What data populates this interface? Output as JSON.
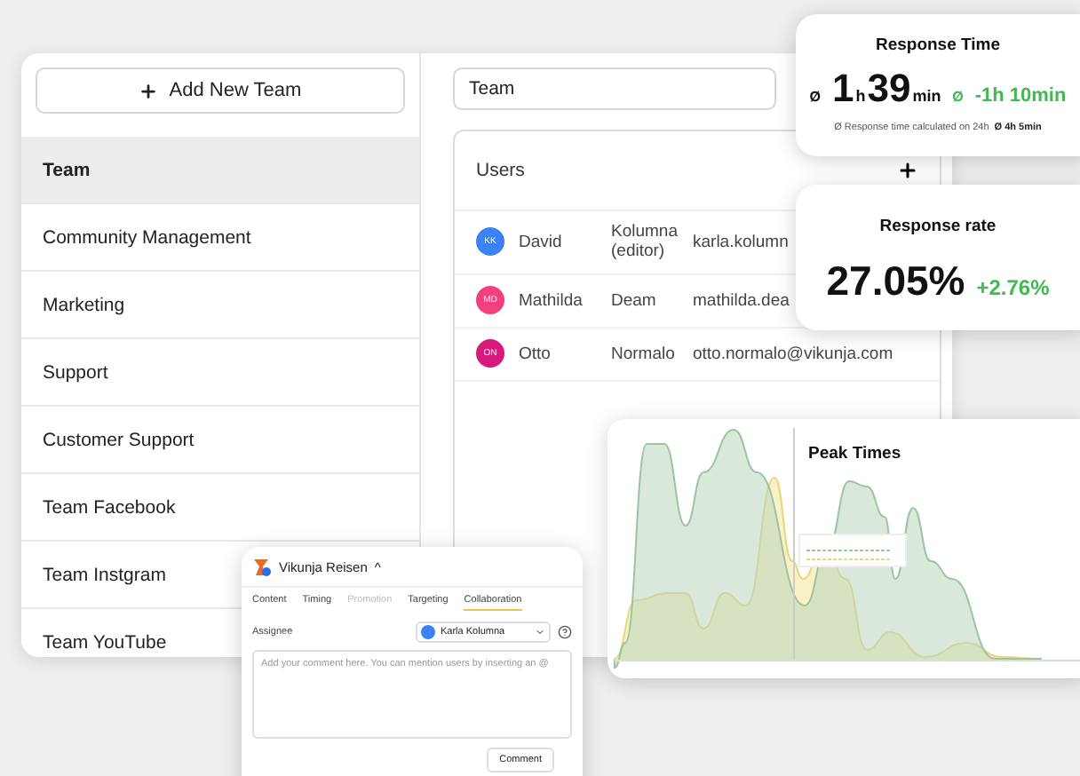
{
  "add_team_button": {
    "label": "Add New Team"
  },
  "teams": [
    {
      "name": "Team",
      "selected": true
    },
    {
      "name": "Community Management",
      "selected": false
    },
    {
      "name": "Marketing",
      "selected": false
    },
    {
      "name": "Support",
      "selected": false
    },
    {
      "name": "Customer Support",
      "selected": false
    },
    {
      "name": "Team Facebook",
      "selected": false
    },
    {
      "name": "Team Instgram",
      "selected": false
    },
    {
      "name": "Team YouTube",
      "selected": false
    }
  ],
  "team_name_field": {
    "value": "Team"
  },
  "users_card": {
    "title": "Users",
    "users": [
      {
        "initials": "KK",
        "first_name": "David",
        "last_name": "Kolumna (editor)",
        "email": "karla.kolumn",
        "color": "#3b82f6"
      },
      {
        "initials": "MD",
        "first_name": "Mathilda",
        "last_name": "Deam",
        "email": "mathilda.dea",
        "color": "#f43f7f"
      },
      {
        "initials": "ON",
        "first_name": "Otto",
        "last_name": "Normalo",
        "email": "otto.normalo@vikunja.com",
        "color": "#d6197a"
      }
    ]
  },
  "response_time": {
    "title": "Response Time",
    "symbol": "Ø",
    "hours": "1",
    "hours_unit": "h",
    "minutes": "39",
    "minutes_unit": "min",
    "change_symbol": "Ø",
    "change": "-1h 10min",
    "note": "Ø Response time calculated on 24h",
    "note_value": "Ø 4h 5min"
  },
  "response_rate": {
    "title": "Response rate",
    "value": "27.05%",
    "change": "+2.76%"
  },
  "peak_times": {
    "title": "Peak Times"
  },
  "comment_popup": {
    "account": "Vikunja Reisen",
    "caret": "^",
    "tabs": [
      {
        "label": "Content",
        "selected": false,
        "disabled": false
      },
      {
        "label": "Timing",
        "selected": false,
        "disabled": false
      },
      {
        "label": "Promotion",
        "selected": false,
        "disabled": true
      },
      {
        "label": "Targeting",
        "selected": false,
        "disabled": false
      },
      {
        "label": "Collaboration",
        "selected": true,
        "disabled": false
      }
    ],
    "assignee_label": "Assignee",
    "assignee": "Karla Kolumna",
    "comment_placeholder": "Add your comment here. You can mention users by inserting an @",
    "submit_button": "Comment"
  }
}
